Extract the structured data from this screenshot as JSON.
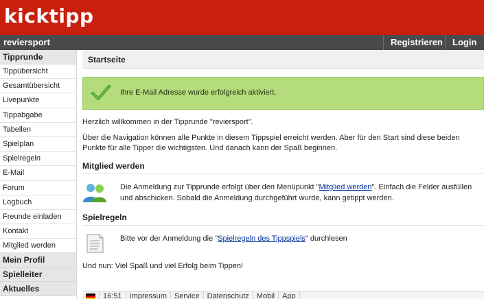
{
  "brand": {
    "logo": "kicktipp",
    "color": "#c8200d"
  },
  "subbar": {
    "group": "reviersport",
    "register": "Registrieren",
    "login": "Login"
  },
  "sidebar": {
    "heading": "Tipprunde",
    "items": [
      "Tippübersicht",
      "Gesamtübersicht",
      "Livepunkte",
      "Tippabgabe",
      "Tabellen",
      "Spielplan",
      "Spielregeln",
      "E-Mail",
      "Forum",
      "Logbuch",
      "Freunde einladen",
      "Kontakt",
      "Mitglied werden"
    ],
    "sections": [
      "Mein Profil",
      "Spielleiter",
      "Aktuelles"
    ]
  },
  "main": {
    "title": "Startseite",
    "success": {
      "icon": "checkmark-icon",
      "text": "Ihre E-Mail Adresse wurde erfolgreich aktiviert."
    },
    "welcome": "Herzlich willkommen in der Tipprunde \"reviersport\".",
    "intro": "Über die Navigation können alle Punkte in diesem Tippspiel erreicht werden. Aber für den Start sind diese beiden Punkte für alle Tipper die wichtigsten. Und danach kann der Spaß beginnen.",
    "member": {
      "title": "Mitglied werden",
      "icon": "users-icon",
      "before": "Die Anmeldung zur Tipprunde erfolgt über den Menüpunkt \"",
      "link": "Mitglied werden",
      "after": "\". Einfach die Felder ausfüllen und abschicken. Sobald die Anmeldung durchgeführt wurde, kann getippt werden."
    },
    "rules": {
      "title": "Spielregeln",
      "icon": "document-icon",
      "before": "Bitte vor der Anmeldung die \"",
      "link": "Spielregeln des Tippspiels",
      "after": "\" durchlesen"
    },
    "closing": "Und nun: Viel Spaß und viel Erfolg beim Tippen!"
  },
  "footer": {
    "flag": "german-flag-icon",
    "time": "16:51",
    "links": [
      "Impressum",
      "Service",
      "Datenschutz",
      "Mobil",
      "App"
    ]
  }
}
